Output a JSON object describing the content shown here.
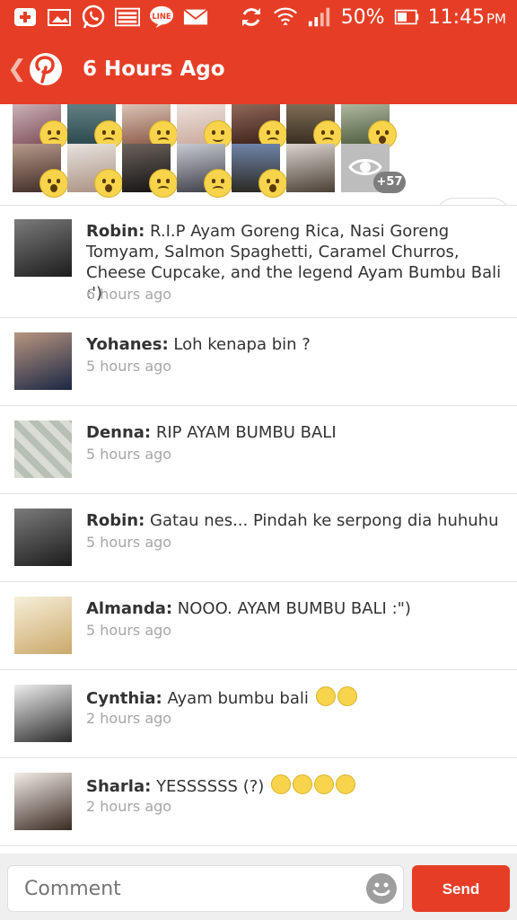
{
  "status_bar": {
    "icons": [
      "add-notification-icon",
      "image-notification-icon",
      "whatsapp-icon",
      "gallery-icon",
      "line-icon",
      "email-icon",
      "sync-icon",
      "wifi-icon",
      "signal-icon",
      "battery-icon"
    ],
    "line_label": "LINE",
    "battery": "50%",
    "time": "11:45",
    "ampm": "PM"
  },
  "header": {
    "back_icon": "chevron-left-icon",
    "logo_icon": "pinterest-logo-icon",
    "title": "6 Hours Ago"
  },
  "reactions": {
    "row1": [
      "sad",
      "sad",
      "sad",
      "smile",
      "sad",
      "sad",
      "surprised"
    ],
    "row2": [
      "surprised",
      "surprised",
      "sad",
      "sad",
      "surprised",
      "none"
    ],
    "more_count": "+57",
    "like_icon": "heart-icon"
  },
  "comments": [
    {
      "author": "Robin:",
      "text": "R.I.P Ayam Goreng Rica, Nasi Goreng Tomyam, Salmon Spaghetti, Caramel Churros, Cheese Cupcake, and the legend Ayam Bumbu Bali :')",
      "time": "6 hours ago"
    },
    {
      "author": "Yohanes:",
      "text": "Loh kenapa bin ?",
      "time": "5 hours ago"
    },
    {
      "author": "Denna:",
      "text": "RIP AYAM BUMBU BALI",
      "time": "5 hours ago"
    },
    {
      "author": "Robin:",
      "text": "Gatau nes... Pindah ke serpong dia huhuhu",
      "time": "5 hours ago"
    },
    {
      "author": "Almanda:",
      "text": "NOOO. AYAM BUMBU BALI :\")",
      "time": "5 hours ago"
    },
    {
      "author": "Cynthia:",
      "text": "Ayam bumbu bali",
      "time": "2 hours ago"
    },
    {
      "author": "Sharla:",
      "text": "YESSSSSS (?)",
      "time": "2 hours ago"
    }
  ],
  "composer": {
    "placeholder": "Comment",
    "send_label": "Send"
  },
  "colors": {
    "brand": "#e63e26",
    "muted_text": "#a6a6a6"
  }
}
